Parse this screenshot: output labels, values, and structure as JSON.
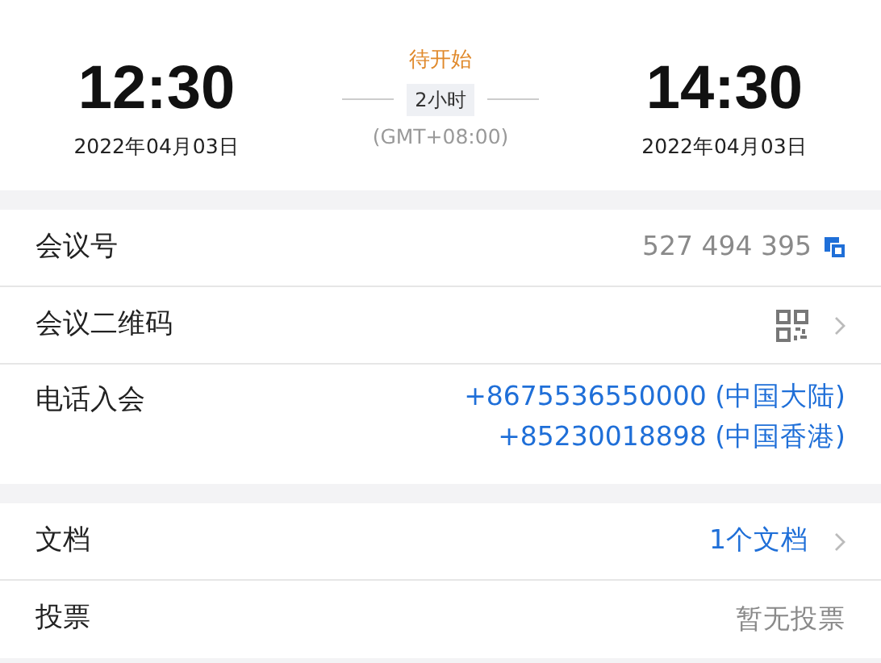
{
  "schedule": {
    "start": {
      "time": "12:30",
      "date": "2022年04月03日"
    },
    "status": "待开始",
    "duration": "2小时",
    "timezone": "(GMT+08:00)",
    "end": {
      "time": "14:30",
      "date": "2022年04月03日"
    }
  },
  "sections": [
    [
      {
        "kind": "copy",
        "label": "会议号",
        "values": [
          "527 494 395"
        ]
      },
      {
        "kind": "qr",
        "label": "会议二维码"
      },
      {
        "kind": "phones",
        "label": "电话入会",
        "values": [
          "+8675536550000 (中国大陆)",
          "+85230018898 (中国香港)"
        ]
      }
    ],
    [
      {
        "kind": "link",
        "label": "文档",
        "values": [
          "1个文档"
        ]
      },
      {
        "kind": "plain",
        "label": "投票",
        "values": [
          "暂无投票"
        ]
      }
    ]
  ]
}
